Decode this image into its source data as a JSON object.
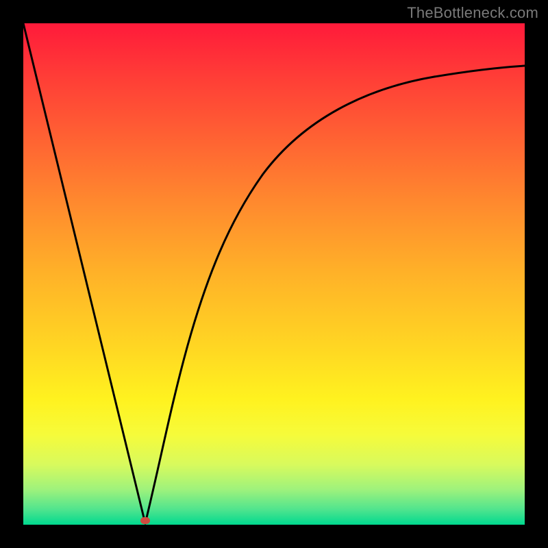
{
  "watermark": "TheBottleneck.com",
  "colors": {
    "frame": "#000000",
    "gradient_top": "#ff1a3a",
    "gradient_mid": "#ffd523",
    "gradient_bottom": "#00d98f",
    "curve": "#000000",
    "marker": "#d14a3f"
  },
  "chart_data": {
    "type": "line",
    "title": "",
    "xlabel": "",
    "ylabel": "",
    "xlim": [
      0,
      100
    ],
    "ylim": [
      0,
      100
    ],
    "series": [
      {
        "name": "left-segment",
        "x": [
          0,
          24
        ],
        "y": [
          100,
          0
        ]
      },
      {
        "name": "right-segment",
        "x": [
          24,
          27,
          30,
          34,
          38,
          43,
          50,
          58,
          67,
          78,
          100
        ],
        "y": [
          0,
          12,
          24,
          36,
          47,
          57,
          67,
          75,
          81,
          86,
          91
        ]
      }
    ],
    "annotations": [
      {
        "name": "min-marker",
        "x": 24,
        "y": 0
      }
    ],
    "grid": false,
    "legend": false
  }
}
